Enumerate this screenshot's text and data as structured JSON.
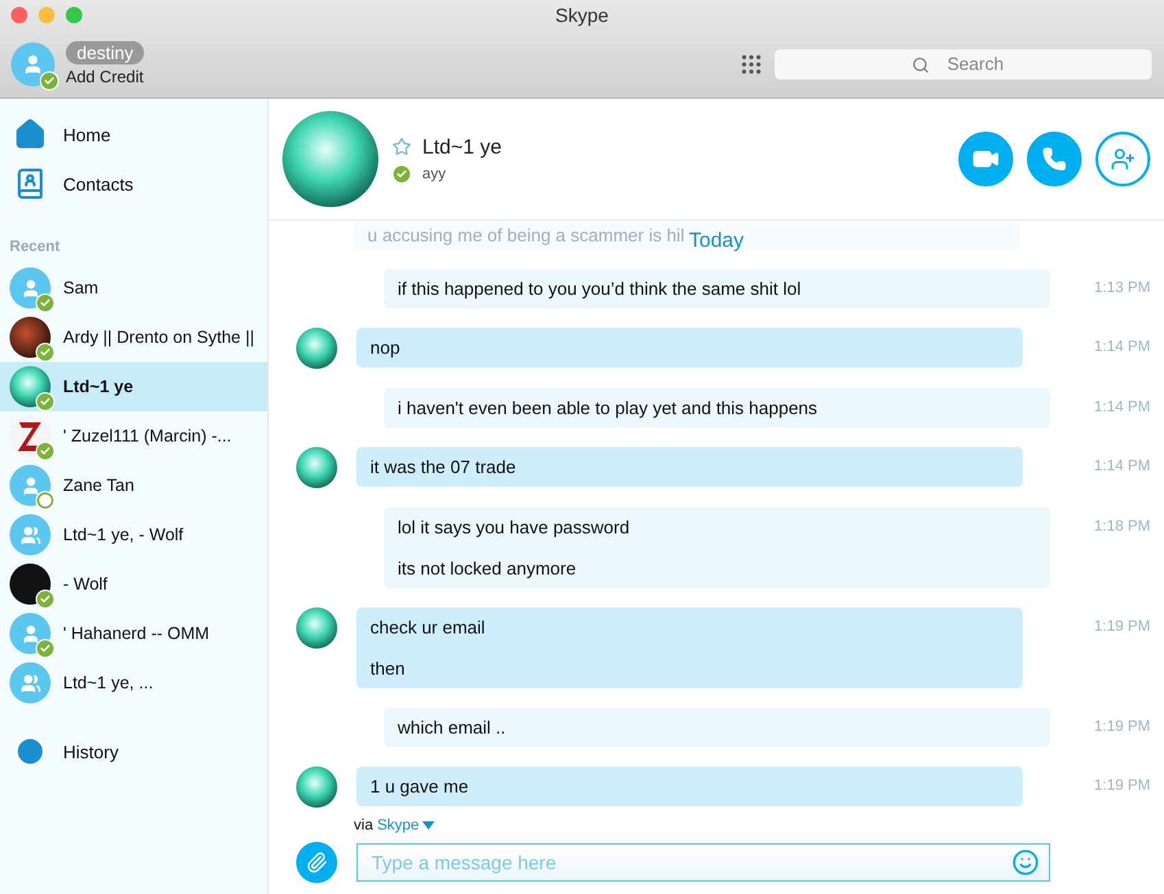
{
  "window": {
    "title": "Skype"
  },
  "account": {
    "name": "destiny",
    "credit": "Add Credit",
    "online": true
  },
  "search": {
    "placeholder": "Search"
  },
  "nav": [
    {
      "label": "Home",
      "kind": "home"
    },
    {
      "label": "Contacts",
      "kind": "contacts"
    }
  ],
  "recent_heading": "Recent",
  "recent": [
    {
      "name": "Sam",
      "kind": "person",
      "online": true,
      "selected": false
    },
    {
      "name": "Ardy || Drento on Sythe ||",
      "kind": "photo",
      "online": true,
      "selected": false
    },
    {
      "name": "Ltd~1 ye",
      "kind": "aurora",
      "online": true,
      "selected": true
    },
    {
      "name": "' Zuzel111 (Marcin) -...",
      "kind": "letter",
      "online": true,
      "selected": false
    },
    {
      "name": "Zane Tan",
      "kind": "person",
      "online": false,
      "selected": false
    },
    {
      "name": "Ltd~1 ye, - Wolf",
      "kind": "group",
      "selected": false
    },
    {
      "name": "- Wolf",
      "kind": "wolf",
      "online": true,
      "selected": false
    },
    {
      "name": "' Hahanerd -- OMM",
      "kind": "person",
      "online": true,
      "selected": false
    },
    {
      "name": "Ltd~1 ye, ...",
      "kind": "group",
      "selected": false
    }
  ],
  "history": {
    "label": "History"
  },
  "chat": {
    "name": "Ltd~1 ye",
    "mood": "ayy",
    "online": true,
    "favorite": false
  },
  "faded_message": "u accusing me of being a scammer is hil",
  "day_label": "Today",
  "messages": [
    {
      "kind": "outgoing",
      "lines": [
        "if this happened to you you’d think the same shit lol"
      ],
      "time": "1:13 PM"
    },
    {
      "kind": "incoming",
      "lines": [
        "nop"
      ],
      "time": "1:14 PM"
    },
    {
      "kind": "outgoing",
      "lines": [
        "i haven't even been able to play yet and this happens"
      ],
      "time": "1:14 PM"
    },
    {
      "kind": "incoming",
      "lines": [
        "it was the 07 trade"
      ],
      "time": "1:14 PM"
    },
    {
      "kind": "outgoing",
      "lines": [
        "lol it says you have password",
        "its not locked anymore"
      ],
      "time": "1:18 PM"
    },
    {
      "kind": "incoming",
      "lines": [
        "check ur email",
        "then"
      ],
      "time": "1:19 PM"
    },
    {
      "kind": "outgoing",
      "lines": [
        "which email .."
      ],
      "time": "1:19 PM"
    },
    {
      "kind": "incoming",
      "lines": [
        "1 u gave me"
      ],
      "time": "1:19 PM"
    }
  ],
  "via": {
    "prefix": "via",
    "service": "Skype"
  },
  "composer": {
    "placeholder": "Type a message here"
  }
}
